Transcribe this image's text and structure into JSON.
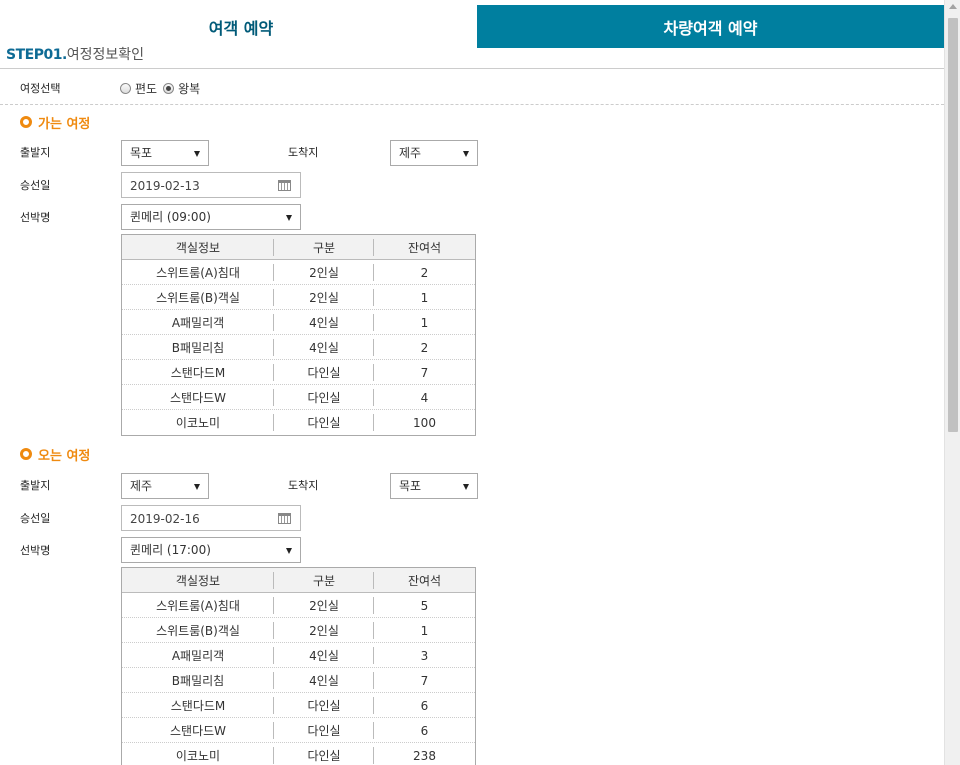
{
  "tabs": [
    {
      "label": "여객 예약",
      "active": true
    },
    {
      "label": "차량여객 예약",
      "active": false
    }
  ],
  "step": {
    "label": "STEP01.",
    "title": "여정정보확인"
  },
  "trip_type": {
    "label": "여정선택",
    "options": [
      {
        "label": "편도",
        "checked": false
      },
      {
        "label": "왕복",
        "checked": true
      }
    ]
  },
  "outbound": {
    "title": "가는 여정",
    "departure_label": "출발지",
    "departure_value": "목포",
    "arrival_label": "도착지",
    "arrival_value": "제주",
    "date_label": "승선일",
    "date_value": "2019-02-13",
    "ship_label": "선박명",
    "ship_value": "퀸메리 (09:00)",
    "table": {
      "headers": [
        "객실정보",
        "구분",
        "잔여석"
      ],
      "rows": [
        [
          "스위트룸(A)침대",
          "2인실",
          "2"
        ],
        [
          "스위트룸(B)객실",
          "2인실",
          "1"
        ],
        [
          "A패밀리객",
          "4인실",
          "1"
        ],
        [
          "B패밀리침",
          "4인실",
          "2"
        ],
        [
          "스탠다드M",
          "다인실",
          "7"
        ],
        [
          "스탠다드W",
          "다인실",
          "4"
        ],
        [
          "이코노미",
          "다인실",
          "100"
        ]
      ]
    }
  },
  "inbound": {
    "title": "오는 여정",
    "departure_label": "출발지",
    "departure_value": "제주",
    "arrival_label": "도착지",
    "arrival_value": "목포",
    "date_label": "승선일",
    "date_value": "2019-02-16",
    "ship_label": "선박명",
    "ship_value": "퀸메리 (17:00)",
    "table": {
      "headers": [
        "객실정보",
        "구분",
        "잔여석"
      ],
      "rows": [
        [
          "스위트룸(A)침대",
          "2인실",
          "5"
        ],
        [
          "스위트룸(B)객실",
          "2인실",
          "1"
        ],
        [
          "A패밀리객",
          "4인실",
          "3"
        ],
        [
          "B패밀리침",
          "4인실",
          "7"
        ],
        [
          "스탠다드M",
          "다인실",
          "6"
        ],
        [
          "스탠다드W",
          "다인실",
          "6"
        ],
        [
          "이코노미",
          "다인실",
          "238"
        ]
      ]
    }
  },
  "colors": {
    "tab_active_text": "#005a78",
    "tab_inactive_bg": "#007f9f",
    "section_accent": "#ef8a10",
    "step_label": "#0e6b95"
  },
  "icons": {
    "section": "ring-icon",
    "calendar": "calendar-icon",
    "dropdown": "chevron-down-icon"
  }
}
